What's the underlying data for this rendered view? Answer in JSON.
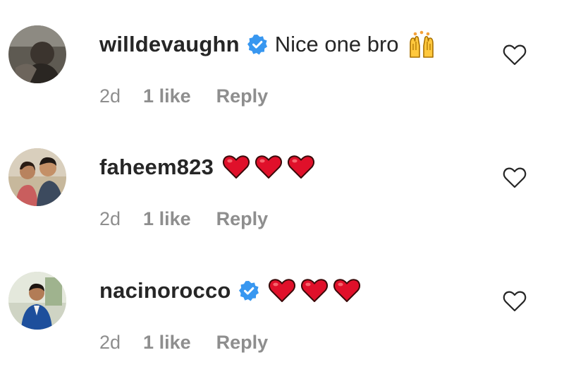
{
  "comments": [
    {
      "username": "willdevaughn",
      "verified": true,
      "text": "Nice one bro",
      "emoji": "raising-hands",
      "time": "2d",
      "likes": "1 like",
      "reply_label": "Reply"
    },
    {
      "username": "faheem823",
      "verified": false,
      "text": "",
      "emoji": "three-red-hearts",
      "time": "2d",
      "likes": "1 like",
      "reply_label": "Reply"
    },
    {
      "username": "nacinorocco",
      "verified": true,
      "text": "",
      "emoji": "three-red-hearts",
      "time": "2d",
      "likes": "1 like",
      "reply_label": "Reply"
    }
  ],
  "colors": {
    "username": "#262626",
    "meta": "#8e8e8e",
    "verified_badge": "#3897f0",
    "heart_emoji": "#e0102a"
  },
  "icons": {
    "like": "heart-outline-icon",
    "verified": "verified-badge-icon"
  }
}
